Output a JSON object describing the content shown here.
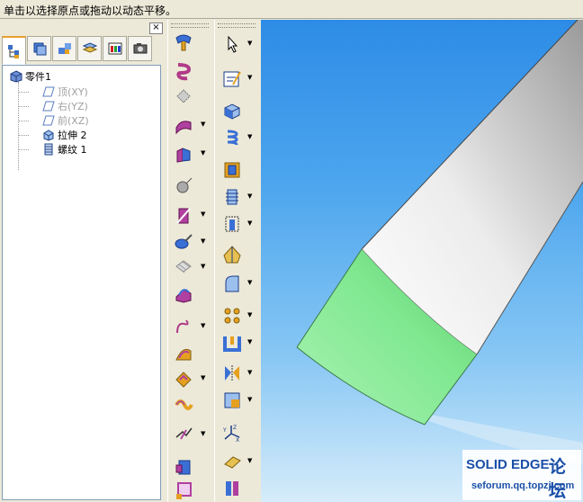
{
  "status_bar": {
    "message": "单击以选择原点或拖动以动态平移。"
  },
  "pathfinder": {
    "close_label": "×",
    "tabs": [
      "feature-tree-icon",
      "parts-library-icon",
      "assembly-icon",
      "layers-icon",
      "color-icon",
      "camera-icon"
    ],
    "tree": {
      "root": "零件1",
      "items": [
        {
          "label": "顶(XY)",
          "type": "plane",
          "dim": true
        },
        {
          "label": "右(YZ)",
          "type": "plane",
          "dim": true
        },
        {
          "label": "前(XZ)",
          "type": "plane",
          "dim": true
        },
        {
          "label": "拉伸 2",
          "type": "extrude",
          "dim": false
        },
        {
          "label": "螺纹 1",
          "type": "thread",
          "dim": false
        }
      ]
    }
  },
  "toolbar_left": [
    "sweep-icon",
    "helix-icon",
    "loft-icon",
    "swept-protrusion-icon",
    "normal-cut-icon",
    "sphere-icon",
    "slot-icon",
    "lip-icon",
    "web-network-icon",
    "emboss-icon",
    "curve-icon",
    "surface-icon",
    "offset-icon",
    "thicken-icon",
    "split-icon",
    "partition-icon",
    "frame-icon"
  ],
  "toolbar_right": [
    "select-arrow-icon",
    "sketch-icon",
    "extrude-icon",
    "revolve-icon",
    "hole-icon",
    "thread-icon",
    "thread-feature-icon",
    "rib-icon",
    "draft-icon",
    "round-icon",
    "pattern-icon",
    "thin-wall-icon",
    "mirror-icon",
    "chamfer-icon",
    "coordinate-system-icon",
    "plane-icon",
    "mirror-part-icon"
  ],
  "viewport": {
    "background_top": "#2d8ce6",
    "thread_color": "#7fe88f",
    "body_color": "#eeeeee"
  },
  "watermark": {
    "brand": "SOLID EDGE",
    "forum": "论坛",
    "url": "seforum.qq.topzj.com"
  }
}
